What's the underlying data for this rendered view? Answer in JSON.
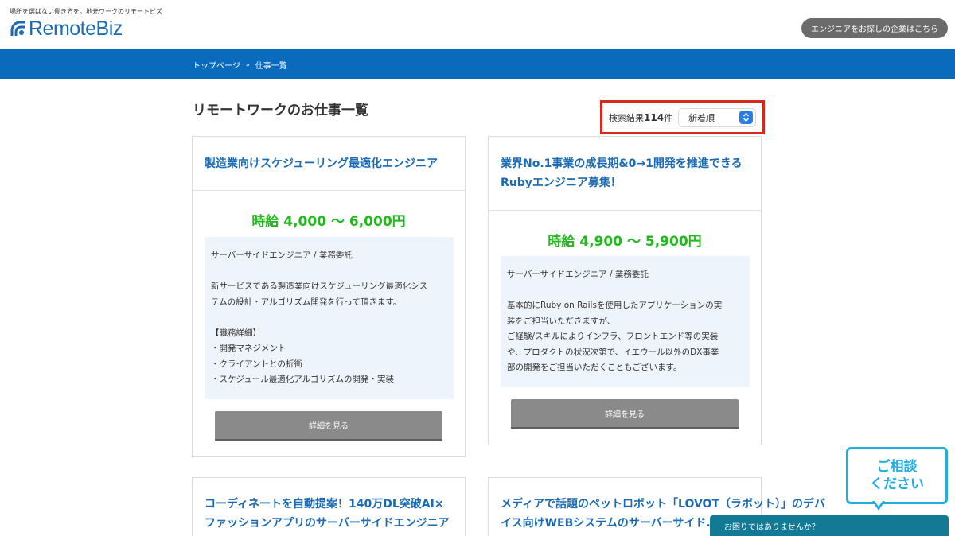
{
  "header": {
    "tagline": "場所を選ばない働き方を。地元ワークのリモートビズ",
    "logo_text_remote": "Remote",
    "logo_text_biz": "Biz",
    "company_button": "エンジニアをお探しの企業はこちら"
  },
  "breadcrumb": {
    "home": "トップページ",
    "separator": "»",
    "current": "仕事一覧"
  },
  "page_title": "リモートワークのお仕事一覧",
  "search": {
    "result_prefix": "検索結果",
    "result_count": "114",
    "result_suffix": "件",
    "sort_selected": "新着順"
  },
  "jobs": [
    {
      "title_lines": [
        "製造業向けスケジューリング最適化エンジニア"
      ],
      "wage": "時給 4,000 〜 6,000円",
      "desc_lines": [
        "サーバーサイドエンジニア / 業務委託",
        "",
        "新サービスである製造業向けスケジューリング最適化シス",
        "テムの設計・アルゴリズム開発を行って頂きます。",
        "",
        "【職務詳細】",
        "・開発マネジメント",
        "・クライアントとの折衝",
        "・スケジュール最適化アルゴリズムの開発・実装"
      ],
      "button": "詳細を見る"
    },
    {
      "title_lines": [
        "業界No.1事業の成長期&0→1開発を推進できる",
        "Rubyエンジニア募集！"
      ],
      "wage": "時給 4,900 〜 5,900円",
      "desc_lines": [
        "サーバーサイドエンジニア / 業務委託",
        "",
        "基本的にRuby on Railsを使用したアプリケーションの実",
        "装をご担当いただきますが、",
        "ご経験/スキルによりインフラ、フロントエンド等の実装",
        "や、プロダクトの状況次第で、イエウール以外のDX事業",
        "部の開発をご担当いただくこともございます。"
      ],
      "button": "詳細を見る"
    },
    {
      "title_lines": [
        "コーディネートを自動提案！140万DL突破AI×",
        "ファッションアプリのサーバーサイドエンジニア"
      ]
    },
    {
      "title_lines": [
        "メディアで話題のペットロボット「LOVOT（ラボット）」のデバ",
        "イス向けWEBシステムのサーバーサイド..."
      ]
    }
  ],
  "chat": {
    "bubble_line1": "ご相談",
    "bubble_line2": "ください",
    "bar_text": "お困りではありませんか？"
  },
  "colors": {
    "brand_blue": "#0a6bbd",
    "title_blue": "#1a6ab3",
    "wage_green": "#22b81e",
    "highlight_red": "#d9291c",
    "chat_cyan": "#21aee0",
    "chat_bar": "#137a95"
  }
}
